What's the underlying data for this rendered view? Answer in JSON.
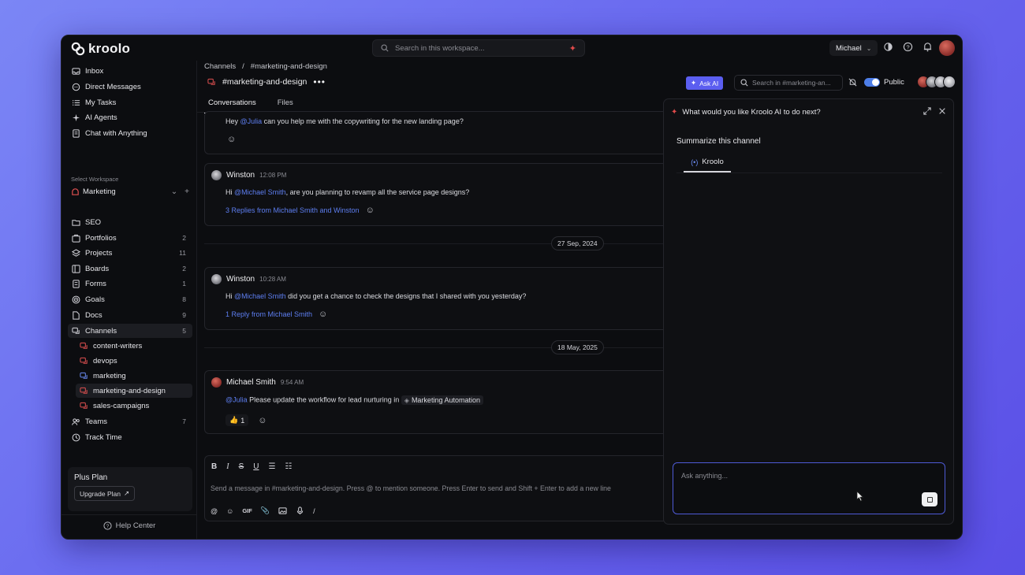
{
  "app": {
    "logo_text": "kroolo",
    "search_placeholder": "Search in this workspace...",
    "user_name": "Michael"
  },
  "sidebar": {
    "top_items": [
      {
        "label": "Inbox",
        "icon": "inbox-icon"
      },
      {
        "label": "Direct Messages",
        "icon": "message-icon"
      },
      {
        "label": "My Tasks",
        "icon": "tasks-icon"
      },
      {
        "label": "AI Agents",
        "icon": "sparkle-icon"
      },
      {
        "label": "Chat with Anything",
        "icon": "chat-doc-icon"
      }
    ],
    "workspace_label": "Select Workspace",
    "workspace_name": "Marketing",
    "items": [
      {
        "label": "SEO",
        "count": ""
      },
      {
        "label": "Portfolios",
        "count": "2"
      },
      {
        "label": "Projects",
        "count": "11"
      },
      {
        "label": "Boards",
        "count": "2"
      },
      {
        "label": "Forms",
        "count": "1"
      },
      {
        "label": "Goals",
        "count": "8"
      },
      {
        "label": "Docs",
        "count": "9"
      },
      {
        "label": "Channels",
        "count": "5"
      }
    ],
    "channels": [
      {
        "label": "content-writers"
      },
      {
        "label": "devops"
      },
      {
        "label": "marketing"
      },
      {
        "label": "marketing-and-design"
      },
      {
        "label": "sales-campaigns"
      }
    ],
    "bottom_items": [
      {
        "label": "Teams",
        "count": "7"
      },
      {
        "label": "Track Time",
        "count": ""
      }
    ],
    "plan": {
      "title": "Plus Plan",
      "upgrade_label": "Upgrade Plan"
    },
    "help_label": "Help Center"
  },
  "channel": {
    "breadcrumb_root": "Channels",
    "breadcrumb_sep": "/",
    "breadcrumb_current": "#marketing-and-design",
    "title": "#marketing-and-design",
    "tabs": [
      "Conversations",
      "Files"
    ],
    "ask_ai_label": "Ask AI",
    "search_placeholder": "Search in #marketing-an...",
    "visibility_label": "Public"
  },
  "messages": [
    {
      "prefix": "Hey ",
      "mention": "@Julia",
      "text": " can you help me with the copywriting for the new landing page?"
    },
    {
      "author": "Winston",
      "time": "12:08 PM",
      "prefix": "Hi ",
      "mention": "@Michael Smith",
      "text": ", are you planning to revamp all the service page designs?",
      "replies": "3 Replies from Michael Smith and Winston"
    },
    {
      "author": "Winston",
      "time": "10:28 AM",
      "prefix": "Hi ",
      "mention": "@Michael Smith",
      "text": " did you get a chance to check the designs that I shared with you yesterday?",
      "replies": "1 Reply from Michael Smith"
    },
    {
      "author": "Michael Smith",
      "time": "9:54 AM",
      "mention": "@Julia",
      "text": " Please update the workflow for lead nurturing in ",
      "tag": "Marketing Automation",
      "reaction_count": "1"
    }
  ],
  "dates": [
    "27 Sep, 2024",
    "18 May, 2025"
  ],
  "composer": {
    "placeholder": "Send a message in #marketing-and-design. Press @ to mention someone. Press Enter to send and Shift + Enter to add a new line",
    "gif_label": "GIF",
    "slash_label": "/"
  },
  "ai_panel": {
    "title": "What would you like Kroolo AI to do next?",
    "prompt": "Summarize this channel",
    "tab_label": "Kroolo",
    "input_placeholder": "Ask anything..."
  },
  "colors": {
    "accent": "#5b5ef0",
    "mention": "#5d7ef0",
    "background": "#0c0d10",
    "toggle": "#4d7ee8"
  }
}
